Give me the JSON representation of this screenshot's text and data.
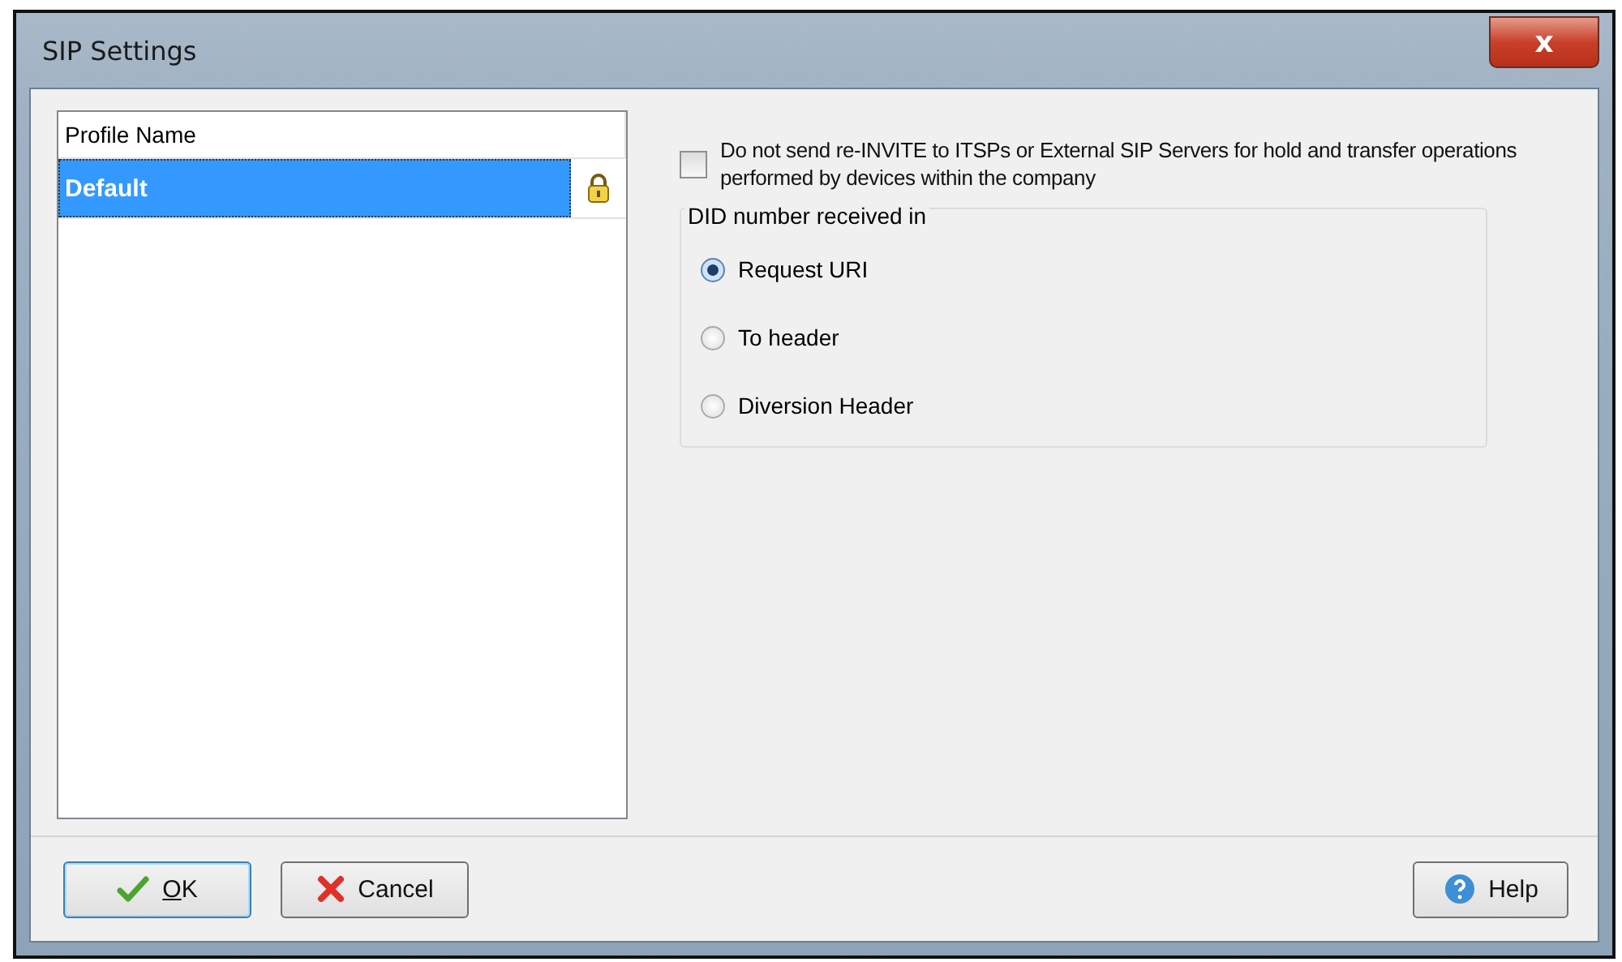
{
  "window": {
    "title": "SIP Settings",
    "close_label": "x"
  },
  "profiles": {
    "column": "Profile Name",
    "rows": [
      {
        "name": "Default",
        "selected": true,
        "locked": true
      }
    ]
  },
  "reinvite": {
    "label": "Do not send re-INVITE to ITSPs or External SIP Servers for hold and transfer operations performed by devices within the company",
    "checked": false
  },
  "did": {
    "title": "DID number received in",
    "options": [
      {
        "label": "Request URI",
        "selected": true
      },
      {
        "label": "To header",
        "selected": false
      },
      {
        "label": "Diversion Header",
        "selected": false
      }
    ]
  },
  "buttons": [
    {
      "label": "OK",
      "kind": "ok"
    },
    {
      "label": "Cancel",
      "kind": "cancel"
    },
    {
      "label": "Help",
      "kind": "help"
    }
  ]
}
